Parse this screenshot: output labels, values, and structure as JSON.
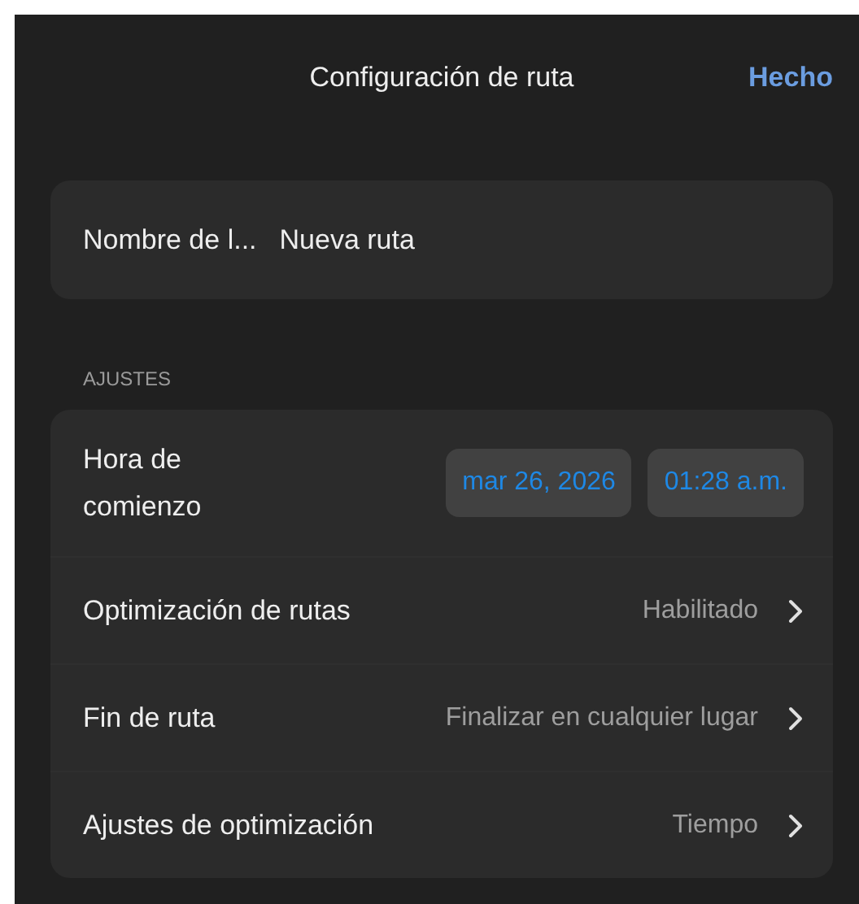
{
  "header": {
    "title": "Configuración de ruta",
    "done": "Hecho"
  },
  "name_field": {
    "label": "Nombre de l...",
    "value": "Nueva ruta"
  },
  "section": {
    "title": "AJUSTES"
  },
  "start_time": {
    "label": "Hora de comienzo",
    "date": "mar 26, 2026",
    "time": "01:28 a.m."
  },
  "rows": [
    {
      "label": "Optimización de rutas",
      "value": "Habilitado"
    },
    {
      "label": "Fin de ruta",
      "value": "Finalizar en cualquier lugar"
    },
    {
      "label": "Ajustes de optimización",
      "value": "Tiempo"
    }
  ]
}
